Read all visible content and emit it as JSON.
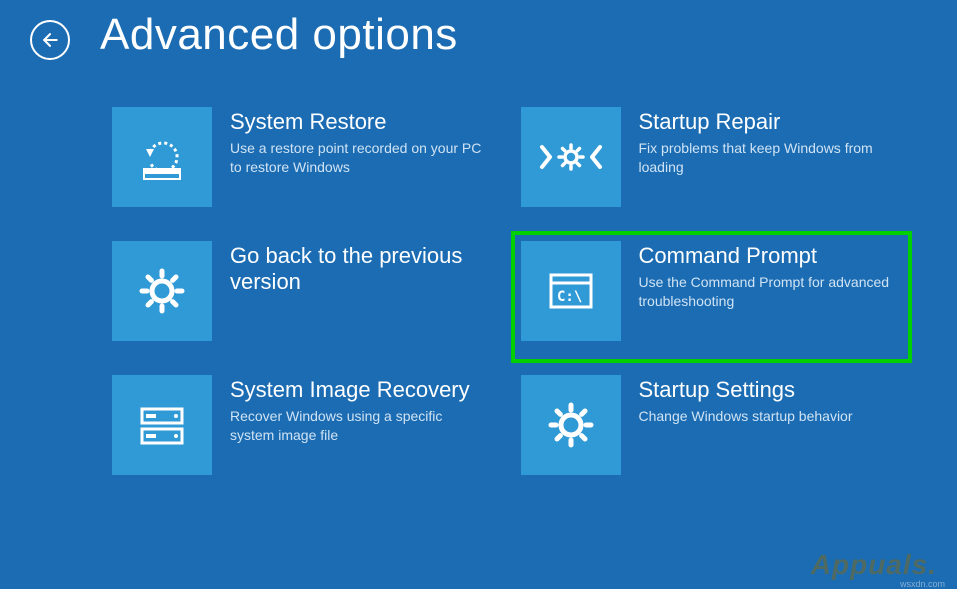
{
  "page_title": "Advanced options",
  "options": [
    {
      "title": "System Restore",
      "desc": "Use a restore point recorded on your PC to restore Windows",
      "icon": "restore"
    },
    {
      "title": "Startup Repair",
      "desc": "Fix problems that keep Windows from loading",
      "icon": "repair"
    },
    {
      "title": "Go back to the previous version",
      "desc": "",
      "icon": "gear"
    },
    {
      "title": "Command Prompt",
      "desc": "Use the Command Prompt for advanced troubleshooting",
      "icon": "cmd",
      "highlighted": true
    },
    {
      "title": "System Image Recovery",
      "desc": "Recover Windows using a specific system image file",
      "icon": "image-recovery"
    },
    {
      "title": "Startup Settings",
      "desc": "Change Windows startup behavior",
      "icon": "gear"
    }
  ],
  "watermark": "Appuals.",
  "watermark_small": "wsxdn.com",
  "highlight_color": "#00d000"
}
